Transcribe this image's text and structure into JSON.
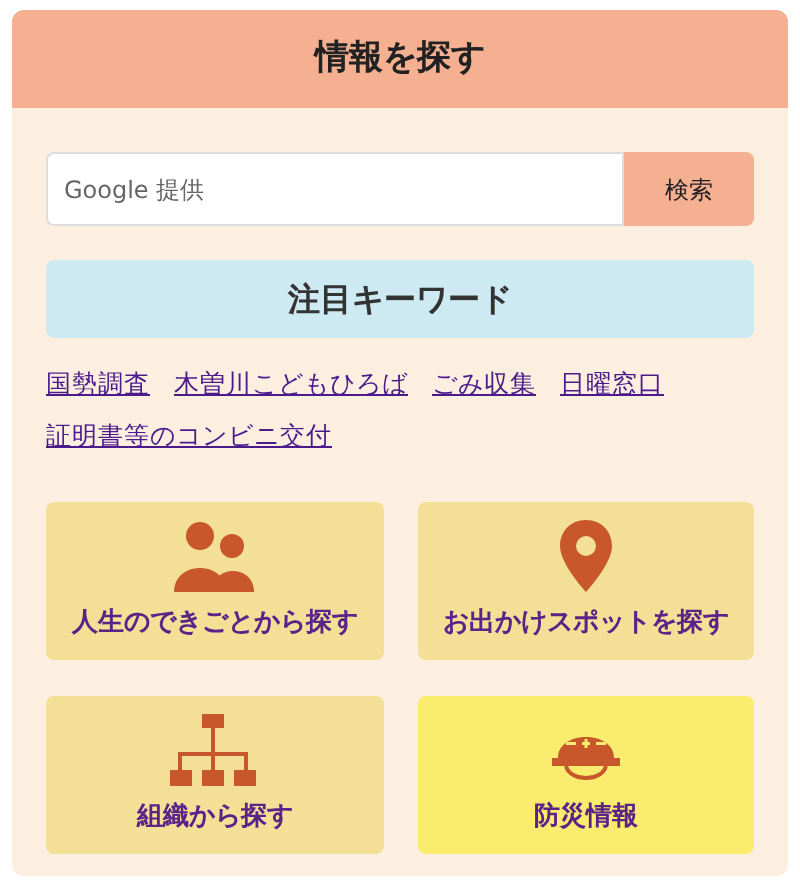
{
  "panel": {
    "title": "情報を探す"
  },
  "search": {
    "placeholder": "Google 提供",
    "button": "検索"
  },
  "keywords": {
    "title": "注目キーワード",
    "links": [
      "国勢調査",
      "木曽川こどもひろば",
      "ごみ収集",
      "日曜窓口",
      "証明書等のコンビニ交付"
    ]
  },
  "tiles": [
    {
      "label": "人生のできごとから探す",
      "kind": "people",
      "color": "#f3e096"
    },
    {
      "label": "お出かけスポットを探す",
      "kind": "pin",
      "color": "#f3e096"
    },
    {
      "label": "組織から探す",
      "kind": "org",
      "color": "#f3e096"
    },
    {
      "label": "防災情報",
      "kind": "helmet",
      "color": "#f9ec6e"
    }
  ]
}
